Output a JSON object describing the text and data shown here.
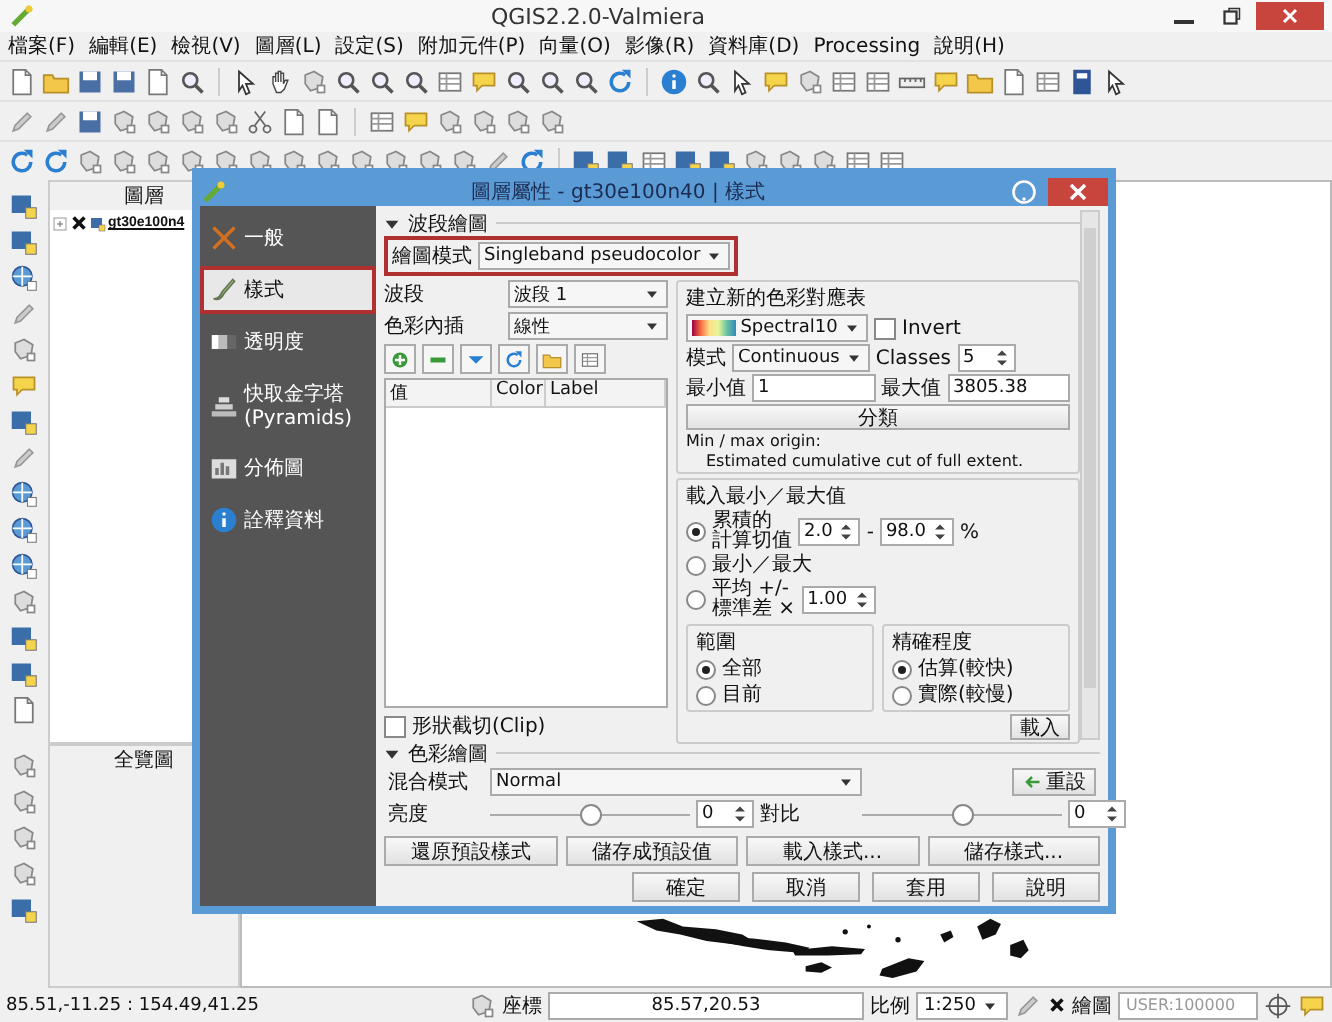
{
  "window": {
    "title": "QGIS2.2.0-Valmiera"
  },
  "menu": [
    "檔案(F)",
    "編輯(E)",
    "檢視(V)",
    "圖層(L)",
    "設定(S)",
    "附加元件(P)",
    "向量(O)",
    "影像(R)",
    "資料庫(D)",
    "Processing",
    "說明(H)"
  ],
  "layers_panel": {
    "title": "圖層",
    "layers": [
      {
        "name": "gt30e100n4",
        "checked": true
      }
    ]
  },
  "overview_panel": {
    "title": "全覽圖"
  },
  "dialog": {
    "title": "圖層屬性 - gt30e100n40 | 樣式",
    "sidebar": [
      {
        "label": "一般",
        "selected": false
      },
      {
        "label": "樣式",
        "selected": true
      },
      {
        "label": "透明度",
        "selected": false
      },
      {
        "label": "快取金字塔(Pyramids)",
        "selected": false
      },
      {
        "label": "分佈圖",
        "selected": false
      },
      {
        "label": "詮釋資料",
        "selected": false
      }
    ],
    "band_section": {
      "title": "波段繪圖",
      "expanded": true,
      "render_type": {
        "label": "繪圖模式",
        "value": "Singleband pseudocolor",
        "highlighted": true
      },
      "band": {
        "label": "波段",
        "value": "波段 1"
      },
      "interpolation": {
        "label": "色彩內插",
        "value": "線性"
      },
      "columns": [
        "值",
        "Color",
        "Label"
      ],
      "clip": {
        "label": "形狀截切(Clip)",
        "checked": false
      },
      "color_map": {
        "title": "建立新的色彩對應表",
        "ramp": "Spectral10",
        "invert": {
          "label": "Invert",
          "checked": false
        },
        "mode_label": "模式",
        "mode": "Continuous",
        "classes_label": "Classes",
        "classes": "5",
        "min_label": "最小值",
        "min": "1",
        "max_label": "最大值",
        "max": "3805.38",
        "classify_button": "分類",
        "origin_title": "Min / max origin:",
        "origin_text": "Estimated cumulative cut of full extent."
      },
      "load": {
        "title": "載入最小／最大值",
        "options": [
          {
            "kind": "cumulative",
            "label_lines": [
              "累積的",
              "計算切值"
            ],
            "from": "2.0",
            "separator": "-",
            "to": "98.0",
            "unit": "%",
            "selected": true
          },
          {
            "kind": "minmax",
            "label": "最小／最大",
            "selected": false
          },
          {
            "kind": "stddev",
            "label_lines": [
              "平均 +/-",
              "標準差 ×"
            ],
            "factor": "1.00",
            "selected": false
          }
        ],
        "extent": {
          "title": "範圍",
          "options": [
            {
              "label": "全部",
              "selected": true
            },
            {
              "label": "目前",
              "selected": false
            }
          ]
        },
        "accuracy": {
          "title": "精確程度",
          "options": [
            {
              "label": "估算(較快)",
              "selected": true
            },
            {
              "label": "實際(較慢)",
              "selected": false
            }
          ]
        },
        "button": "載入"
      }
    },
    "color_section": {
      "title": "色彩繪圖",
      "expanded": true,
      "blend_label": "混合模式",
      "blend": "Normal",
      "reset_button": "重設",
      "brightness": {
        "label": "亮度",
        "level": 0.5,
        "value": "0"
      },
      "contrast": {
        "label": "對比",
        "level": 0.5,
        "value": "0"
      }
    },
    "style_buttons": [
      "還原預設樣式",
      "儲存成預設值",
      "載入樣式...",
      "儲存樣式..."
    ],
    "footer_buttons": [
      "確定",
      "取消",
      "套用",
      "說明"
    ]
  },
  "status_bar": {
    "extent": "85.51,-11.25 : 154.49,41.25",
    "coordinate_label": "座標",
    "coordinate": "85.57,20.53",
    "scale_label": "比例",
    "scale": "1:250",
    "render": {
      "label": "繪圖",
      "checked": true
    },
    "crs": "USER:100000"
  }
}
